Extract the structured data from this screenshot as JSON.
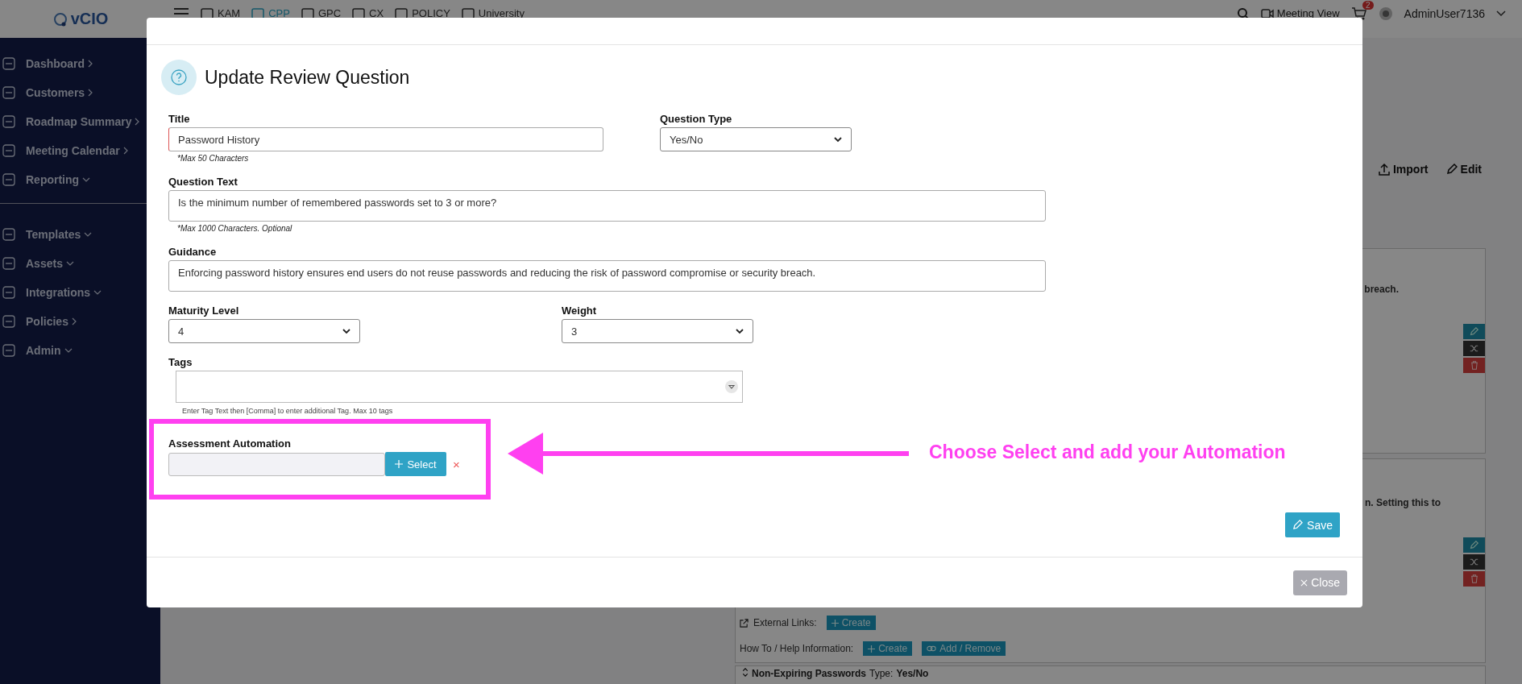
{
  "logo": {
    "text": "vCIO"
  },
  "topbar": {
    "nav": [
      {
        "label": "KAM",
        "selected": false
      },
      {
        "label": "CPP",
        "selected": true
      },
      {
        "label": "GPC",
        "selected": false
      },
      {
        "label": "CX",
        "selected": false
      },
      {
        "label": "POLICY",
        "selected": false
      },
      {
        "label": "University",
        "selected": false
      }
    ],
    "meeting_view": "Meeting View",
    "cart_badge": "2",
    "user": "AdminUser7136"
  },
  "sidebar": {
    "groups": [
      {
        "items": [
          {
            "label": "Dashboard",
            "kind": "link"
          },
          {
            "label": "Customers",
            "kind": "link"
          },
          {
            "label": "Roadmap Summary",
            "kind": "link"
          },
          {
            "label": "Meeting Calendar",
            "kind": "link"
          },
          {
            "label": "Reporting",
            "kind": "group"
          }
        ]
      },
      {
        "items": [
          {
            "label": "Templates",
            "kind": "group"
          },
          {
            "label": "Assets",
            "kind": "group"
          },
          {
            "label": "Integrations",
            "kind": "group"
          },
          {
            "label": "Policies",
            "kind": "link"
          },
          {
            "label": "Admin",
            "kind": "group"
          }
        ]
      }
    ]
  },
  "page": {
    "toolbar": [
      {
        "label": "Import",
        "kind": "import"
      },
      {
        "label": "Edit",
        "kind": "edit"
      }
    ],
    "cards": [
      {
        "text": "breach."
      },
      {
        "text": "n. Setting this to",
        "link_rows": [
          {
            "label": "External Links:",
            "buttons": [
              {
                "label": "Create",
                "kind": "create"
              }
            ]
          },
          {
            "label": "How To / Help Information:",
            "buttons": [
              {
                "label": "Create",
                "kind": "create"
              },
              {
                "label": "Add / Remove",
                "kind": "link"
              }
            ]
          }
        ]
      }
    ],
    "last_card": {
      "title": "Non-Expiring Passwords",
      "type_label": "Type:",
      "type_value": "Yes/No"
    }
  },
  "modal": {
    "title": "Update Review Question",
    "title_field": {
      "label": "Title",
      "value": "Password History",
      "hint": "*Max 50 Characters"
    },
    "question_type": {
      "label": "Question Type",
      "value": "Yes/No"
    },
    "question_text": {
      "label": "Question Text",
      "value": "Is the minimum number of remembered passwords set to 3 or more?",
      "hint": "*Max 1000 Characters. Optional"
    },
    "guidance": {
      "label": "Guidance",
      "value": "Enforcing password history ensures end users do not reuse passwords and reducing the risk of password compromise or security breach."
    },
    "maturity": {
      "label": "Maturity Level",
      "value": "4"
    },
    "weight": {
      "label": "Weight",
      "value": "3"
    },
    "tags": {
      "label": "Tags",
      "hint": "Enter Tag Text then [Comma] to enter additional Tag. Max 10 tags"
    },
    "automation": {
      "label": "Assessment Automation",
      "button": "Select",
      "clear": "×"
    },
    "save": "Save",
    "close": "Close"
  },
  "annotation": {
    "text": "Choose Select and add your Automation"
  }
}
